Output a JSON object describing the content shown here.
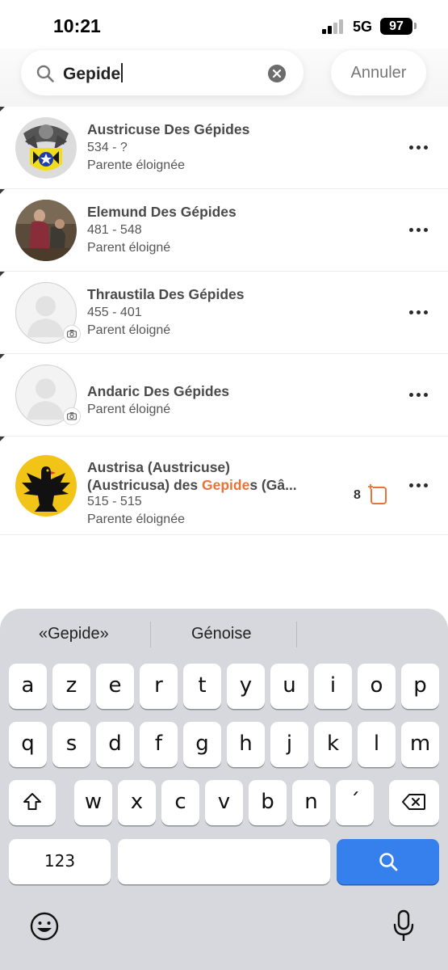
{
  "status_bar": {
    "time": "10:21",
    "network": "5G",
    "battery": "97"
  },
  "search": {
    "query": "Gepide",
    "cancel_label": "Annuler"
  },
  "results": [
    {
      "name": "Austricuse Des Gépides",
      "dates": "534 - ?",
      "relation": "Parente éloignée",
      "avatar": "coat-of-arms"
    },
    {
      "name": "Elemund Des Gépides",
      "dates": "481 - 548",
      "relation": "Parent éloigné",
      "avatar": "painting"
    },
    {
      "name": "Thraustila Des Gépides",
      "dates": "455 - 401",
      "relation": "Parent éloigné",
      "avatar": "placeholder"
    },
    {
      "name": "Andaric Des Gépides",
      "relation": "Parent éloigné",
      "avatar": "placeholder"
    },
    {
      "name_line1": "Austrisa  (Austricuse)",
      "name_line2_pre": "(Austricusa) des ",
      "name_line2_highlight": "Gepide",
      "name_line2_post": "s (Gâ...",
      "dates": "515 - 515",
      "relation": "Parente éloignée",
      "media_count": "8",
      "avatar": "eagle-arms"
    }
  ],
  "keyboard": {
    "suggestions": [
      "«Gepide»",
      "Génoise"
    ],
    "row1": [
      "a",
      "z",
      "e",
      "r",
      "t",
      "y",
      "u",
      "i",
      "o",
      "p"
    ],
    "row2": [
      "q",
      "s",
      "d",
      "f",
      "g",
      "h",
      "j",
      "k",
      "l",
      "m"
    ],
    "row3": [
      "w",
      "x",
      "c",
      "v",
      "b",
      "n",
      "´"
    ],
    "numbers_label": "123"
  },
  "colors": {
    "highlight": "#e6733a",
    "search_key": "#3580ed",
    "keyboard_bg": "#d6d8dd"
  }
}
